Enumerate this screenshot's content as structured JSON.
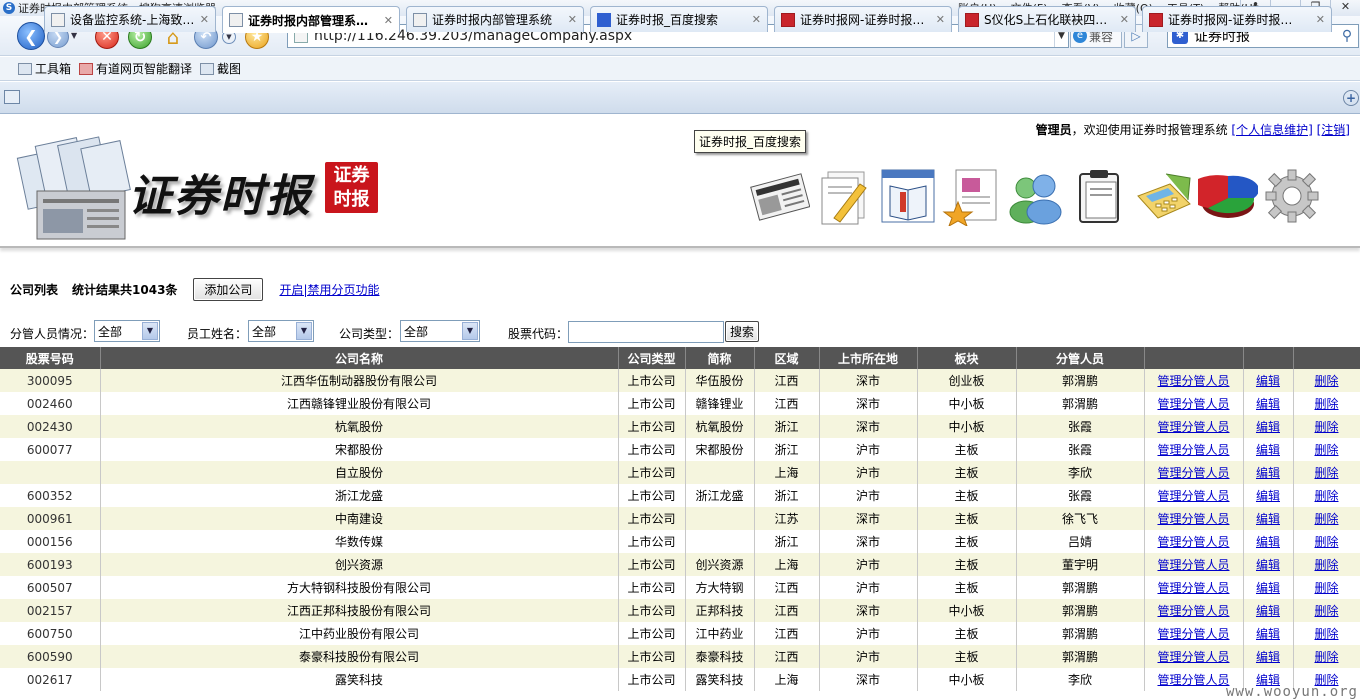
{
  "browser": {
    "title": "证券时报内部管理系统 - 搜狗高速浏览器",
    "menus": [
      "账户(U)",
      "文件(F)",
      "查看(V)",
      "收藏(O)",
      "工具(T)",
      "帮助(H)"
    ],
    "url": "http://116.246.39.203/manageCompany.aspx",
    "compat_label": "兼容",
    "search_value": "证券时报",
    "toolbar_items": [
      "工具箱",
      "有道网页智能翻译",
      "截图"
    ],
    "tabs": [
      {
        "label": "设备监控系统-上海致…",
        "icon": "page-icon",
        "active": false
      },
      {
        "label": "证券时报内部管理系…",
        "icon": "page-icon",
        "active": true
      },
      {
        "label": "证券时报内部管理系统",
        "icon": "page-icon",
        "active": false
      },
      {
        "label": "证券时报_百度搜索",
        "icon": "baidu-icon",
        "active": false
      },
      {
        "label": "证券时报网-证券时报…",
        "icon": "stcn-icon",
        "active": false
      },
      {
        "label": "S仪化S上石化联袂四…",
        "icon": "stcn-icon",
        "active": false
      },
      {
        "label": "证券时报网-证券时报…",
        "icon": "stcn-icon",
        "active": false
      }
    ],
    "tooltip": "证券时报_百度搜索"
  },
  "header": {
    "logo_text": "证券时报",
    "seal_text": [
      "证券",
      "时报"
    ],
    "user_role": "管理员",
    "welcome_text": "，欢迎使用证券时报管理系统",
    "link_profile": "[个人信息维护]",
    "link_logout": "[注销]"
  },
  "list": {
    "title": "公司列表",
    "count_text": "统计结果共1043条",
    "add_button": "添加公司",
    "paging_link": "开启|禁用分页功能"
  },
  "filters": {
    "manager_label": "分管人员情况：",
    "manager_value": "全部",
    "employee_label": "员工姓名：",
    "employee_value": "全部",
    "type_label": "公司类型：",
    "type_value": "全部",
    "code_label": "股票代码：",
    "code_value": "",
    "search_button": "搜索"
  },
  "table": {
    "headers": [
      "股票号码",
      "公司名称",
      "公司类型",
      "简称",
      "区域",
      "上市所在地",
      "板块",
      "分管人员",
      "",
      "",
      ""
    ],
    "action_labels": [
      "管理分管人员",
      "编辑",
      "删除"
    ],
    "rows": [
      [
        "300095",
        "江西华伍制动器股份有限公司",
        "上市公司",
        "华伍股份",
        "江西",
        "深市",
        "创业板",
        "郭渭鹏"
      ],
      [
        "002460",
        "江西赣锋锂业股份有限公司",
        "上市公司",
        "赣锋锂业",
        "江西",
        "深市",
        "中小板",
        "郭渭鹏"
      ],
      [
        "002430",
        "杭氧股份",
        "上市公司",
        "杭氧股份",
        "浙江",
        "深市",
        "中小板",
        "张霞"
      ],
      [
        "600077",
        "宋都股份",
        "上市公司",
        "宋都股份",
        "浙江",
        "沪市",
        "主板",
        "张霞"
      ],
      [
        "",
        "自立股份",
        "上市公司",
        "",
        "上海",
        "沪市",
        "主板",
        "李欣"
      ],
      [
        "600352",
        "浙江龙盛",
        "上市公司",
        "浙江龙盛",
        "浙江",
        "沪市",
        "主板",
        "张霞"
      ],
      [
        "000961",
        "中南建设",
        "上市公司",
        "",
        "江苏",
        "深市",
        "主板",
        "徐飞飞"
      ],
      [
        "000156",
        "华数传媒",
        "上市公司",
        "",
        "浙江",
        "深市",
        "主板",
        "吕婧"
      ],
      [
        "600193",
        "创兴资源",
        "上市公司",
        "创兴资源",
        "上海",
        "沪市",
        "主板",
        "董宇明"
      ],
      [
        "600507",
        "方大特钢科技股份有限公司",
        "上市公司",
        "方大特钢",
        "江西",
        "沪市",
        "主板",
        "郭渭鹏"
      ],
      [
        "002157",
        "江西正邦科技股份有限公司",
        "上市公司",
        "正邦科技",
        "江西",
        "深市",
        "中小板",
        "郭渭鹏"
      ],
      [
        "600750",
        "江中药业股份有限公司",
        "上市公司",
        "江中药业",
        "江西",
        "沪市",
        "主板",
        "郭渭鹏"
      ],
      [
        "600590",
        "泰豪科技股份有限公司",
        "上市公司",
        "泰豪科技",
        "江西",
        "沪市",
        "主板",
        "郭渭鹏"
      ],
      [
        "002617",
        "露笑科技",
        "上市公司",
        "露笑科技",
        "上海",
        "深市",
        "中小板",
        "李欣"
      ]
    ]
  },
  "watermark": "www.wooyun.org"
}
